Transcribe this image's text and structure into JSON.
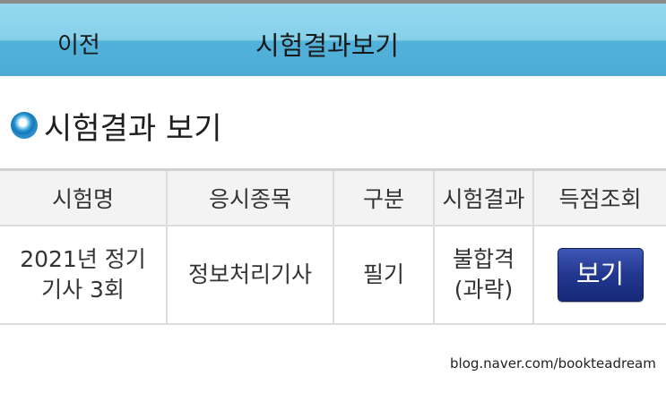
{
  "header": {
    "back_label": "이전",
    "title": "시험결과보기"
  },
  "section": {
    "title": "시험결과 보기"
  },
  "table": {
    "headers": [
      "시험명",
      "응시종목",
      "구분",
      "시험결과",
      "득점조회"
    ],
    "rows": [
      {
        "exam_name_line1": "2021년 정기",
        "exam_name_line2": "기사 3회",
        "subject": "정보처리기사",
        "category": "필기",
        "result_line1": "불합격",
        "result_line2": "(과락)",
        "view_button": "보기"
      }
    ]
  },
  "footer": {
    "credit": "blog.naver.com/bookteadream"
  },
  "colors": {
    "header_top": "#94d8ee",
    "header_bottom": "#4eacd6",
    "button": "#22378f"
  }
}
